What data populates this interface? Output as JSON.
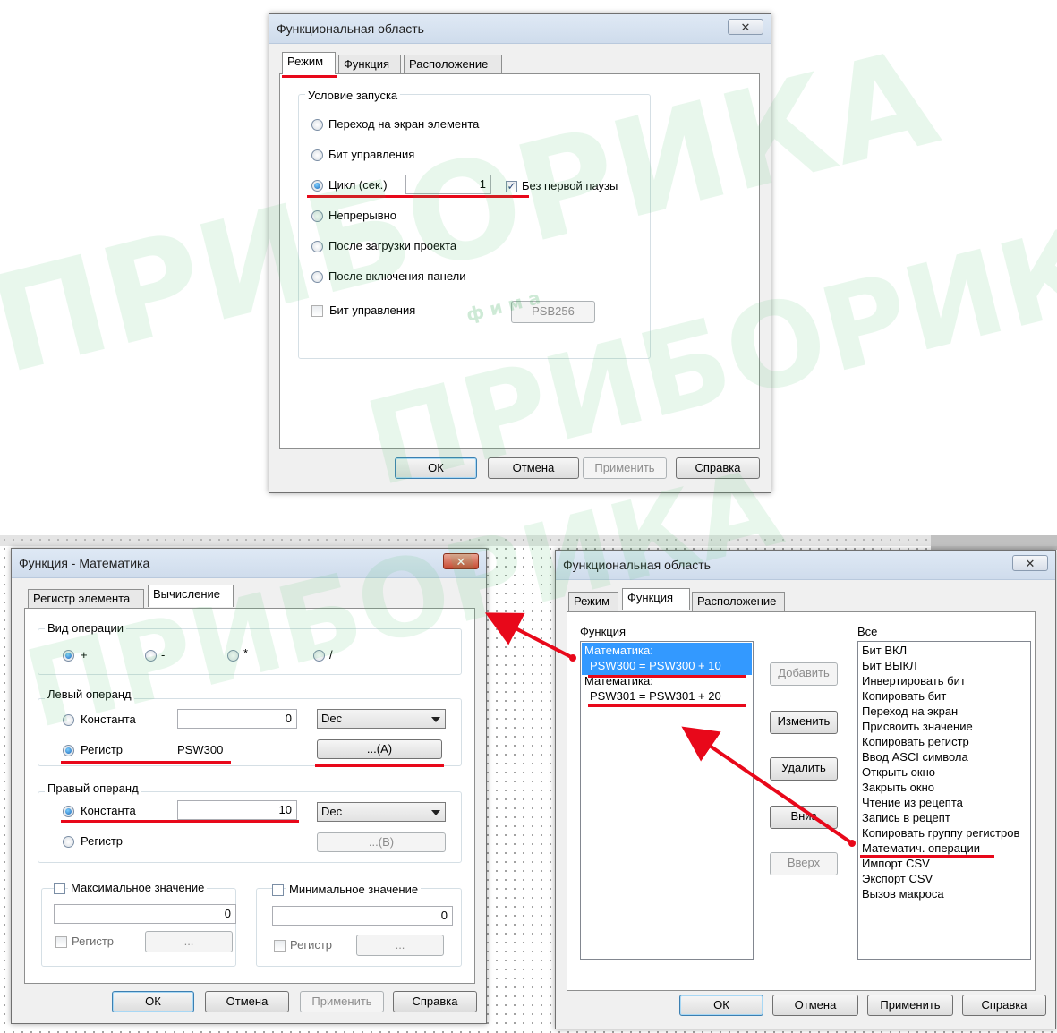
{
  "colors": {
    "accent_red": "#e8081a",
    "selection": "#3399ff",
    "window_bg": "#f0f0f0"
  },
  "watermark": {
    "text": "ПРИБОРИКА",
    "letters": "ф и м а"
  },
  "win1": {
    "title": "Функциональная область",
    "close_glyph": "✕",
    "tabs": [
      "Режим",
      "Функция",
      "Расположение"
    ],
    "group_title": "Условие запуска",
    "options": [
      "Переход на экран элемента",
      "Бит управления",
      "Цикл (сек.)",
      "Непрерывно",
      "После загрузки проекта",
      "После включения панели"
    ],
    "cycle_value": "1",
    "no_first_pause": "Без первой паузы",
    "control_bit_label": "Бит управления",
    "control_bit_value": "PSB256",
    "buttons": {
      "ok": "ОК",
      "cancel": "Отмена",
      "apply": "Применить",
      "help": "Справка"
    }
  },
  "win2": {
    "title": "Функция - Математика",
    "close_glyph": "✕",
    "tabs": [
      "Регистр элемента",
      "Вычисление"
    ],
    "op_group": "Вид операции",
    "ops": [
      "+",
      "-",
      "*",
      "/"
    ],
    "left_group": "Левый операнд",
    "left_const_label": "Константа",
    "left_const_value": "0",
    "left_format": "Dec",
    "left_reg_label": "Регистр",
    "left_reg_value": "PSW300",
    "left_reg_button": "...(A)",
    "right_group": "Правый операнд",
    "right_const_label": "Константа",
    "right_const_value": "10",
    "right_format": "Dec",
    "right_reg_label": "Регистр",
    "right_reg_button": "...(B)",
    "max_label": "Максимальное значение",
    "max_value": "0",
    "min_label": "Минимальное значение",
    "min_value": "0",
    "reg_label": "Регистр",
    "reg_button": "...",
    "buttons": {
      "ok": "ОК",
      "cancel": "Отмена",
      "apply": "Применить",
      "help": "Справка"
    }
  },
  "win3": {
    "title": "Функциональная область",
    "close_glyph": "✕",
    "tabs": [
      "Режим",
      "Функция",
      "Расположение"
    ],
    "func_label": "Функция",
    "all_label": "Все",
    "entries": [
      {
        "name": "Математика:",
        "expr": "PSW300 = PSW300 + 10"
      },
      {
        "name": "Математика:",
        "expr": "PSW301 = PSW301 + 20"
      }
    ],
    "mid_buttons": [
      "Добавить",
      "Изменить",
      "Удалить",
      "Вниз",
      "Вверх"
    ],
    "all_items": [
      "Бит ВКЛ",
      "Бит ВЫКЛ",
      "Инвертировать бит",
      "Копировать бит",
      "Переход на экран",
      "Присвоить значение",
      "Копировать регистр",
      "Ввод ASCI символа",
      "Открыть окно",
      "Закрыть окно",
      "Чтение из рецепта",
      "Запись в рецепт",
      "Копировать группу регистров",
      "Математич. операции",
      "Импорт CSV",
      "Экспорт CSV",
      "Вызов макроса"
    ],
    "buttons": {
      "ok": "ОК",
      "cancel": "Отмена",
      "apply": "Применить",
      "help": "Справка"
    }
  }
}
